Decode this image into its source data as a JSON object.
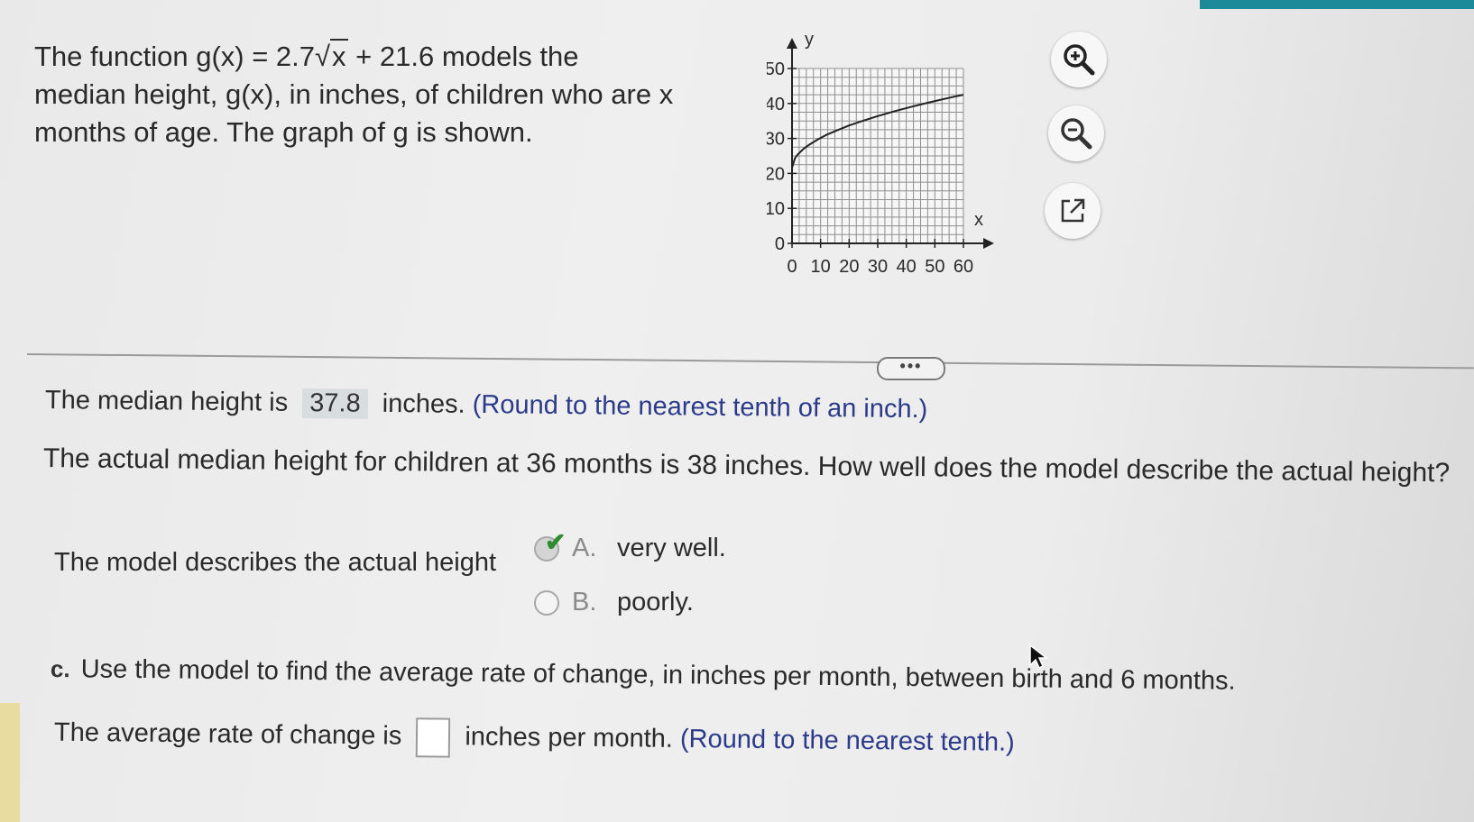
{
  "problem": {
    "line1_prefix": "The function g(x) = 2.7",
    "sqrt_arg": "x",
    "line1_suffix": " + 21.6 models the",
    "line2": "median height, g(x), in inches, of children who are x",
    "line3": "months of age.  The graph of g is shown."
  },
  "chart_data": {
    "type": "line",
    "function": "g(x) = 2.7√x + 21.6",
    "x_axis_label": "x",
    "y_axis_label": "y",
    "x_ticks": [
      0,
      10,
      20,
      30,
      40,
      50,
      60
    ],
    "y_ticks": [
      0,
      10,
      20,
      30,
      40,
      50
    ],
    "xlim": [
      0,
      60
    ],
    "ylim": [
      0,
      50
    ],
    "grid": true,
    "series": [
      {
        "x": [
          0,
          1,
          2,
          4,
          6,
          9,
          12,
          16,
          20,
          25,
          30,
          36,
          42,
          49,
          56,
          60
        ],
        "y": [
          21.6,
          24.3,
          25.4,
          27.0,
          28.2,
          29.7,
          31.0,
          32.4,
          33.7,
          35.1,
          36.4,
          37.8,
          39.1,
          40.5,
          41.8,
          42.5
        ]
      }
    ]
  },
  "tools": {
    "zoom_in_icon": "magnifier-plus-icon",
    "zoom_out_icon": "magnifier-minus-icon",
    "popout_icon": "external-link-icon"
  },
  "more_label": "•••",
  "previous": {
    "prefix": "The median height is",
    "answer": "37.8",
    "suffix": "inches.",
    "hint": "(Round to the nearest tenth of an inch.)"
  },
  "question": "The actual median height for children at 36 months is 38 inches.  How well does the model describe the actual height?",
  "stem": "The model describes the actual height",
  "options": [
    {
      "letter": "A.",
      "text": "very well.",
      "selected": true
    },
    {
      "letter": "B.",
      "text": "poorly.",
      "selected": false
    }
  ],
  "part_c": {
    "tag": "c.",
    "text": "Use the model to find the average rate of change, in inches per month, between birth and 6 months."
  },
  "rate": {
    "prefix": "The average rate of change is",
    "suffix": "inches per month.",
    "hint": "(Round to the nearest tenth.)",
    "value": ""
  },
  "colors": {
    "accent_strip": "#1d8a9a",
    "hint_text": "#2c3a8a",
    "check": "#2e8b2e"
  }
}
